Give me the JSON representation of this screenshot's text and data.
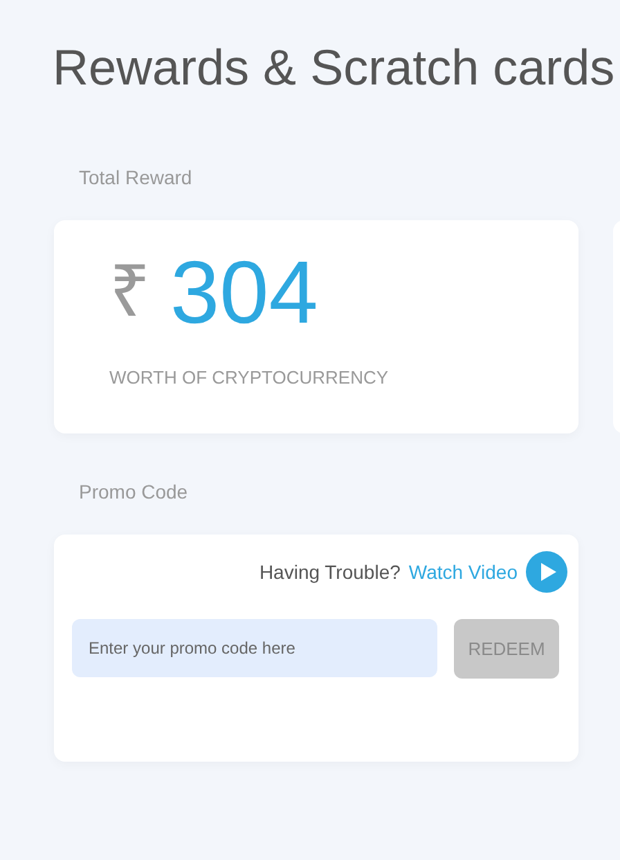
{
  "title": "Rewards & Scratch cards",
  "total_reward": {
    "label": "Total Reward",
    "currency": "₹",
    "amount": "304",
    "caption": "WORTH OF CRYPTOCURRENCY"
  },
  "promo": {
    "label": "Promo Code",
    "trouble_text": "Having Trouble?",
    "link": "Watch Video",
    "placeholder": "Enter your promo code here",
    "button": {
      "label": "REDEEM",
      "disabled": true
    }
  }
}
